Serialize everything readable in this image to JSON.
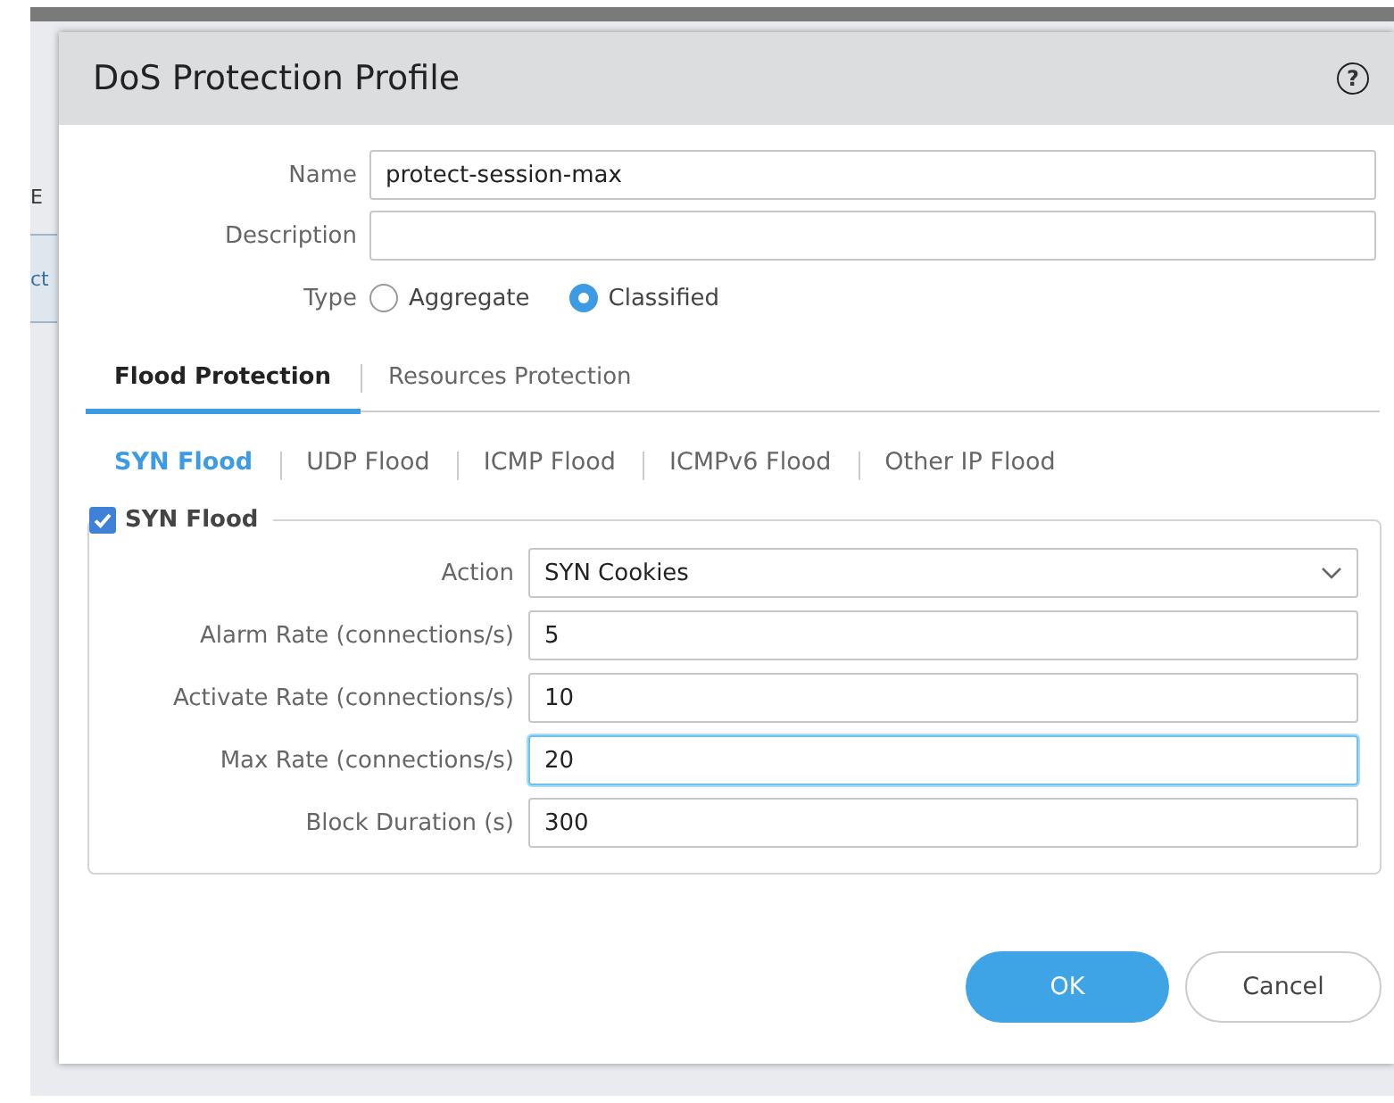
{
  "background": {
    "fragments": [
      {
        "text": "E",
        "kind": "plain"
      },
      {
        "text": "ct",
        "kind": "link"
      }
    ]
  },
  "dialog": {
    "title": "DoS Protection Profile",
    "help": "?",
    "fields": [
      {
        "label": "Name",
        "value": "protect-session-max"
      },
      {
        "label": "Description"
      }
    ],
    "type": {
      "label": "Type",
      "options": [
        {
          "label": "Aggregate",
          "selected": false
        },
        {
          "label": "Classified",
          "selected": true
        }
      ]
    },
    "tabs": [
      {
        "label": "Flood Protection",
        "selected": true
      },
      {
        "label": "Resources Protection",
        "selected": false
      }
    ],
    "subtabs": [
      {
        "label": "SYN Flood",
        "selected": true
      },
      {
        "label": "UDP Flood",
        "selected": false
      },
      {
        "label": "ICMP Flood",
        "selected": false
      },
      {
        "label": "ICMPv6 Flood",
        "selected": false
      },
      {
        "label": "Other IP Flood",
        "selected": false
      }
    ],
    "group": {
      "label": "SYN Flood",
      "checked": true,
      "rows": [
        {
          "kind": "select",
          "label": "Action",
          "value": "SYN Cookies",
          "focused": false
        },
        {
          "kind": "input",
          "label": "Alarm Rate (connections/s)",
          "value": "5",
          "focused": false
        },
        {
          "kind": "input",
          "label": "Activate Rate (connections/s)",
          "value": "10",
          "focused": false
        },
        {
          "kind": "input",
          "label": "Max Rate (connections/s)",
          "value": "20",
          "focused": true
        },
        {
          "kind": "input",
          "label": "Block Duration (s)",
          "value": "300",
          "focused": false
        }
      ]
    },
    "buttons": [
      {
        "label": "OK",
        "kind": "primary"
      },
      {
        "label": "Cancel",
        "kind": "secondary"
      }
    ]
  }
}
